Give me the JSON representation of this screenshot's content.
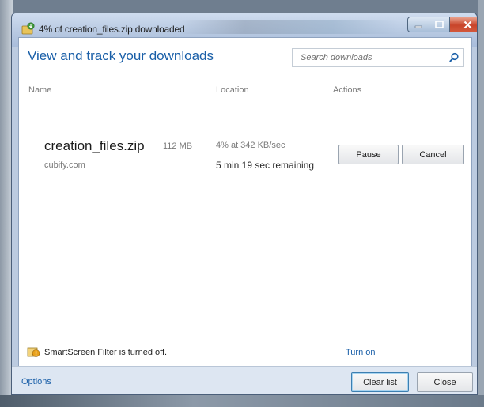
{
  "window": {
    "title": "4% of creation_files.zip downloaded"
  },
  "header": {
    "title": "View and track your downloads",
    "search_placeholder": "Search downloads"
  },
  "columns": {
    "name": "Name",
    "location": "Location",
    "actions": "Actions"
  },
  "downloads": [
    {
      "file_name": "creation_files.zip",
      "source": "cubify.com",
      "size": "112 MB",
      "progress": "4% at 342 KB/sec",
      "progress_percent": 4,
      "remaining": "5 min 19 sec remaining",
      "pause_label": "Pause",
      "cancel_label": "Cancel"
    }
  ],
  "smartscreen": {
    "text": "SmartScreen Filter is turned off.",
    "turn_on_label": "Turn on"
  },
  "footer": {
    "options_label": "Options",
    "clear_list_label": "Clear list",
    "close_label": "Close"
  },
  "icons": {
    "title_icon": "download-icon",
    "search_icon": "search-icon",
    "smartscreen_icon": "shield-warning-icon"
  },
  "colors": {
    "accent": "#1a5fa8",
    "close_button": "#c8452b"
  }
}
